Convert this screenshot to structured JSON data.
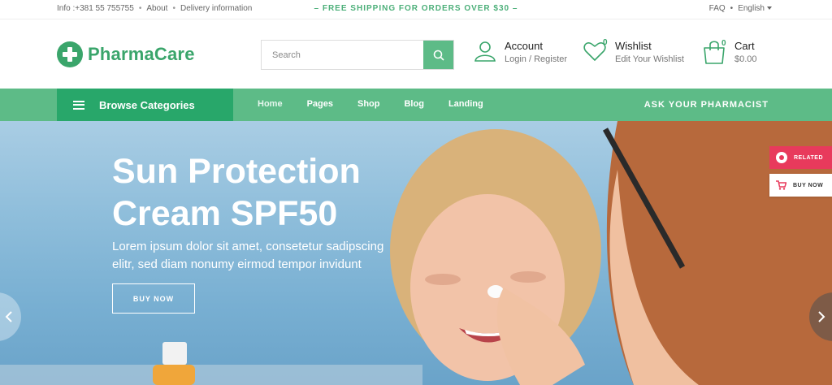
{
  "topbar": {
    "info": "Info :+381 55 755755",
    "about": "About",
    "delivery": "Delivery information",
    "shipping": "– FREE SHIPPING FOR ORDERS OVER $30 –",
    "faq": "FAQ",
    "language": "English"
  },
  "header": {
    "logo_text": "PharmaCare",
    "search_placeholder": "Search",
    "account_title": "Account",
    "account_sub": "Login / Register",
    "wishlist_title": "Wishlist",
    "wishlist_sub": "Edit Your Wishlist",
    "wishlist_count": "0",
    "cart_title": "Cart",
    "cart_total": "$0.00",
    "cart_count": "0"
  },
  "nav": {
    "browse": "Browse Categories",
    "items": [
      "Home",
      "Pages",
      "Shop",
      "Blog",
      "Landing"
    ],
    "ask": "ASK YOUR PHARMACIST"
  },
  "hero": {
    "title": "Sun Protection Cream SPF50",
    "subtitle": "Lorem ipsum dolor sit amet, consetetur sadipscing elitr, sed diam nonumy eirmod tempor invidunt",
    "button": "BUY NOW"
  },
  "side": {
    "related": "RELATED",
    "buy_now": "BUY NOW"
  },
  "colors": {
    "brand": "#3aa56b",
    "nav": "#5dbb87",
    "browse": "#28a76a",
    "related": "#e83a5c"
  }
}
